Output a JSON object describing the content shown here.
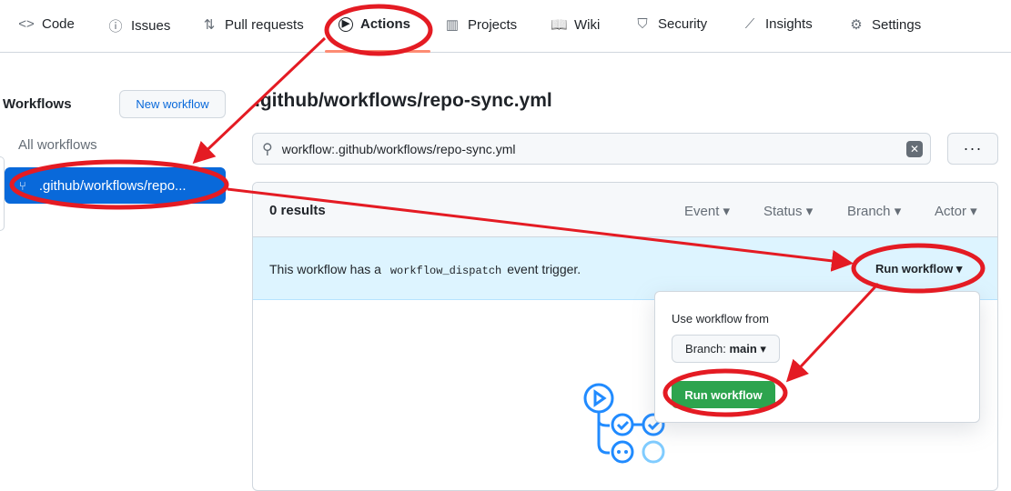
{
  "nav": {
    "items": [
      {
        "label": "Code",
        "icon": "code-icon",
        "glyph": "<>"
      },
      {
        "label": "Issues",
        "icon": "issue-icon",
        "glyph": "ⓘ"
      },
      {
        "label": "Pull requests",
        "icon": "pull-request-icon",
        "glyph": "⇅"
      },
      {
        "label": "Actions",
        "icon": "play-icon",
        "glyph": "▶"
      },
      {
        "label": "Projects",
        "icon": "table-icon",
        "glyph": "▥"
      },
      {
        "label": "Wiki",
        "icon": "book-icon",
        "glyph": "📖"
      },
      {
        "label": "Security",
        "icon": "shield-icon",
        "glyph": "⛉"
      },
      {
        "label": "Insights",
        "icon": "graph-icon",
        "glyph": "⟋"
      },
      {
        "label": "Settings",
        "icon": "gear-icon",
        "glyph": "⚙"
      }
    ],
    "active": "Actions"
  },
  "sidebar": {
    "title": "Workflows",
    "new_workflow": "New workflow",
    "all_workflows": "All workflows",
    "selected": ".github/workflows/repo..."
  },
  "main": {
    "title": ".github/workflows/repo-sync.yml",
    "search_value": "workflow:.github/workflows/repo-sync.yml",
    "more": "···",
    "results": "0 results",
    "filters": [
      "Event",
      "Status",
      "Branch",
      "Actor"
    ],
    "banner_pre": "This workflow has a",
    "banner_code": "workflow_dispatch",
    "banner_post": "event trigger.",
    "run_workflow": "Run workflow"
  },
  "popup": {
    "label": "Use workflow from",
    "branch_prefix": "Branch:",
    "branch": "main",
    "button": "Run workflow"
  },
  "colors": {
    "accent": "#0969da",
    "green": "#2da44e",
    "annotation": "#e41b23"
  }
}
